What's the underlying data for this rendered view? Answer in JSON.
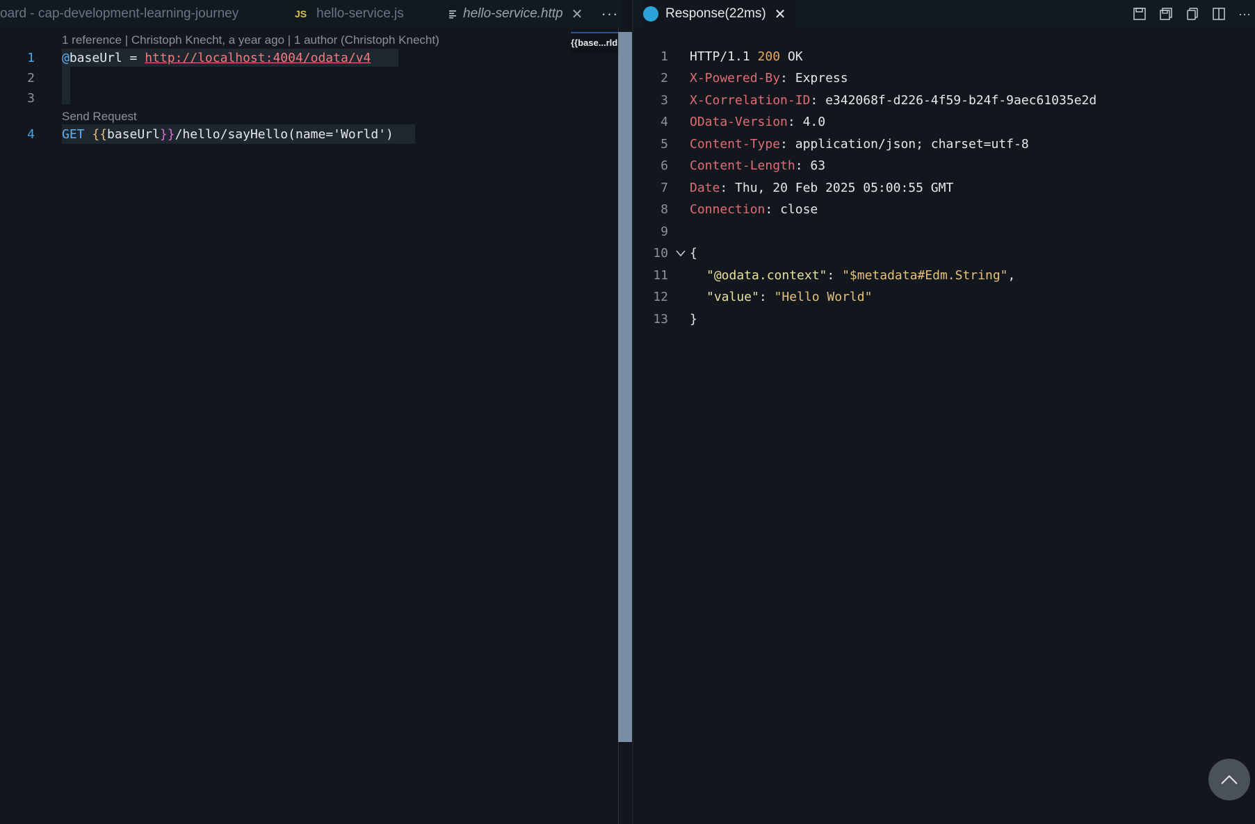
{
  "tabs": {
    "left": [
      {
        "label": "oard - cap-development-learning-journey"
      },
      {
        "label": "hello-service.js",
        "icon": "JS"
      },
      {
        "label": "hello-service.http",
        "active": true
      }
    ],
    "right": {
      "label": "Response(22ms)",
      "close": "✕"
    },
    "close_glyph": "✕",
    "more": "···"
  },
  "breadcrumb": {
    "label": "{{base...rld"
  },
  "left_editor": {
    "codelens_top": "1 reference | Christoph Knecht, a year ago | 1 author (Christoph Knecht)",
    "codelens_send": "Send Request",
    "line_numbers": [
      "1",
      "2",
      "3",
      "4"
    ],
    "line1": {
      "at": "@",
      "var": "baseUrl",
      "eq": " = ",
      "url": "http://localhost:4004/odata/v4"
    },
    "line4": {
      "method": "GET",
      "open": "{{",
      "var": "baseUrl",
      "close": "}}",
      "path": "/hello/sayHello(name='World')"
    }
  },
  "response": {
    "line_numbers": [
      "1",
      "2",
      "3",
      "4",
      "5",
      "6",
      "7",
      "8",
      "9",
      "10",
      "11",
      "12",
      "13"
    ],
    "status_line": {
      "proto": "HTTP/1.1 ",
      "code": "200",
      "text": " OK"
    },
    "headers": [
      {
        "key": "X-Powered-By",
        "value": "Express"
      },
      {
        "key": "X-Correlation-ID",
        "value": "e342068f-d226-4f59-b24f-9aec61035e2d"
      },
      {
        "key": "OData-Version",
        "value": "4.0"
      },
      {
        "key": "Content-Type",
        "value": "application/json; charset=utf-8"
      },
      {
        "key": "Content-Length",
        "value": "63"
      },
      {
        "key": "Date",
        "value": "Thu, 20 Feb 2025 05:00:55 GMT"
      },
      {
        "key": "Connection",
        "value": "close"
      }
    ],
    "body": {
      "open": "{",
      "close": "}",
      "entries": [
        {
          "key": "\"@odata.context\"",
          "value": "\"$metadata#Edm.String\"",
          "trail": ","
        },
        {
          "key": "\"value\"",
          "value": "\"Hello World\"",
          "trail": ""
        }
      ]
    }
  },
  "icons": [
    "save-icon",
    "save-body-icon",
    "copy-icon",
    "split-editor-icon",
    "more-actions-icon",
    "scroll-to-top-icon"
  ],
  "colors": {
    "background": "#11171d",
    "header_key": "#e06c75",
    "status_code": "#e8a85c",
    "json_string": "#e5c07b",
    "line_number_active": "#4aa3e8",
    "url": "#f47b7b"
  }
}
